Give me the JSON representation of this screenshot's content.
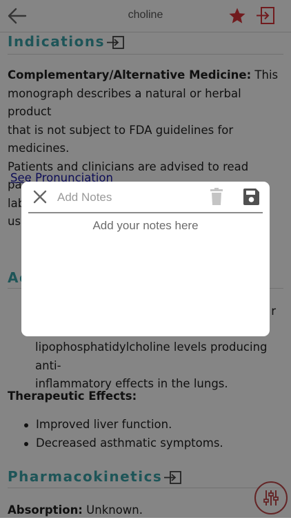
{
  "header": {
    "title": "choline",
    "back_icon": "arrow-left-icon",
    "favorite_icon": "star-icon",
    "exit_icon": "sign-in-icon",
    "favorite_color": "#d9343a"
  },
  "sections": {
    "indications": {
      "heading": "Indications",
      "label": "Complementary/Alternative Medicine:",
      "text_lines": [
        " This",
        "monograph describes a natural or herbal product",
        "that is not subject to FDA guidelines for medicines.",
        "Patients and clinicians are advised to read package",
        "labels carefully to ensure safe and efficacious use."
      ],
      "see_pronunciation": "See Pronunciation"
    },
    "action": {
      "heading_fragment": "Ac",
      "trailing_fragment": "r",
      "continued_lines": [
        "lipophosphatidylcholine levels producing anti-",
        "inflammatory effects in the lungs."
      ]
    },
    "therapeutic_effects": {
      "label": "Therapeutic Effects:",
      "items": [
        "Improved liver function.",
        "Decreased asthmatic symptoms."
      ]
    },
    "pharmacokinetics": {
      "heading": "Pharmacokinetics",
      "absorption_label": "Absorption:",
      "absorption_value": " Unknown."
    }
  },
  "fab": {
    "icon": "sliders-icon",
    "color": "#c0474a"
  },
  "notes_modal": {
    "title_placeholder": "Add Notes",
    "body_placeholder": "Add your notes here",
    "close_icon": "close-icon",
    "delete_icon": "trash-icon",
    "save_icon": "save-icon"
  },
  "colors": {
    "accent_teal": "#3aa3a9",
    "link": "#1a1aa6"
  }
}
